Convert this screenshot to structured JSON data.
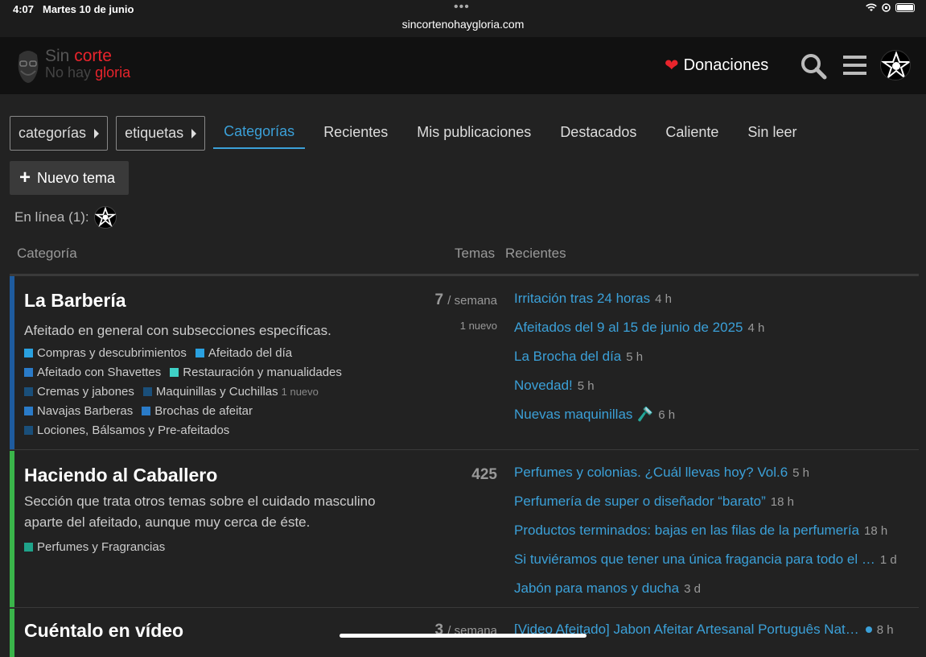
{
  "status_bar": {
    "time": "4:07",
    "date": "Martes 10 de junio",
    "url": "sincortenohaygloria.com"
  },
  "header": {
    "logo_line1_a": "Sin",
    "logo_line1_b": "corte",
    "logo_line2_a": "No hay",
    "logo_line2_b": "gloria",
    "donaciones": "Donaciones",
    "heart_icon": "heart-icon",
    "search_icon": "search-icon",
    "menu_icon": "hamburger-menu-icon"
  },
  "nav": {
    "categories_dropdown": "categorías",
    "tags_dropdown": "etiquetas",
    "tabs": [
      {
        "label": "Categorías",
        "active": true
      },
      {
        "label": "Recientes",
        "active": false
      },
      {
        "label": "Mis publicaciones",
        "active": false
      },
      {
        "label": "Destacados",
        "active": false
      },
      {
        "label": "Caliente",
        "active": false
      },
      {
        "label": "Sin leer",
        "active": false
      }
    ]
  },
  "new_topic": "Nuevo tema",
  "online": "En línea (1):",
  "table_header": {
    "category": "Categoría",
    "topics": "Temas",
    "latest": "Recientes"
  },
  "categories": [
    {
      "title": "La Barbería",
      "color": "#1e5b9e",
      "description": "Afeitado en general con subsecciones específicas.",
      "count": "7",
      "count_unit": "/ semana",
      "new_label": "1 nuevo",
      "subcategories": [
        [
          {
            "name": "Compras y descubrimientos",
            "color": "#2aa1e0"
          },
          {
            "name": "Afeitado del día",
            "color": "#2aa1e0"
          }
        ],
        [
          {
            "name": "Afeitado con Shavettes",
            "color": "#2a7bc8"
          },
          {
            "name": "Restauración y manualidades",
            "color": "#3fd1c6"
          }
        ],
        [
          {
            "name": "Cremas y jabones",
            "color": "#1a4f7a"
          },
          {
            "name": "Maquinillas y Cuchillas",
            "color": "#1a4f7a",
            "extra": "1 nuevo"
          }
        ],
        [
          {
            "name": "Navajas Barberas",
            "color": "#2a7bc8"
          },
          {
            "name": "Brochas de afeitar",
            "color": "#2a7bc8"
          }
        ],
        [
          {
            "name": "Lociones, Bálsamos y Pre-afeitados",
            "color": "#1a4f7a"
          }
        ]
      ],
      "recent": [
        {
          "title": "Irritación tras 24 horas",
          "age": "4 h"
        },
        {
          "title": "Afeitados del 9 al 15 de junio de 2025",
          "age": "4 h"
        },
        {
          "title": "La Brocha del día",
          "age": "5 h"
        },
        {
          "title": "Novedad!",
          "age": "5 h"
        },
        {
          "title": "Nuevas maquinillas 🪒",
          "age": "6 h"
        }
      ]
    },
    {
      "title": "Haciendo al Caballero",
      "color": "#3ab54a",
      "description": "Sección que trata otros temas sobre el cuidado masculino aparte del afeitado, aunque muy cerca de éste.",
      "count": "425",
      "count_unit": "",
      "new_label": "",
      "subcategories": [
        [
          {
            "name": "Perfumes y Fragrancias",
            "color": "#1fa38a"
          }
        ]
      ],
      "recent": [
        {
          "title": "Perfumes y colonias. ¿Cuál llevas hoy? Vol.6",
          "age": "5 h"
        },
        {
          "title": "Perfumería de super o diseñador “barato”",
          "age": "18 h"
        },
        {
          "title": "Productos terminados: bajas en las filas de la perfumería",
          "age": "18 h"
        },
        {
          "title": "Si tuviéramos que tener una única fragancia para todo el …",
          "age": "1 d"
        },
        {
          "title": "Jabón para manos y ducha",
          "age": "3 d"
        }
      ]
    },
    {
      "title": "Cuéntalo en vídeo",
      "color": "#3ab54a",
      "count": "3",
      "count_unit": "/ semana",
      "recent": [
        {
          "title": "[Video Afeitado] Jabon Afeitar Artesanal Português Nat…",
          "age": "8 h"
        }
      ]
    }
  ]
}
